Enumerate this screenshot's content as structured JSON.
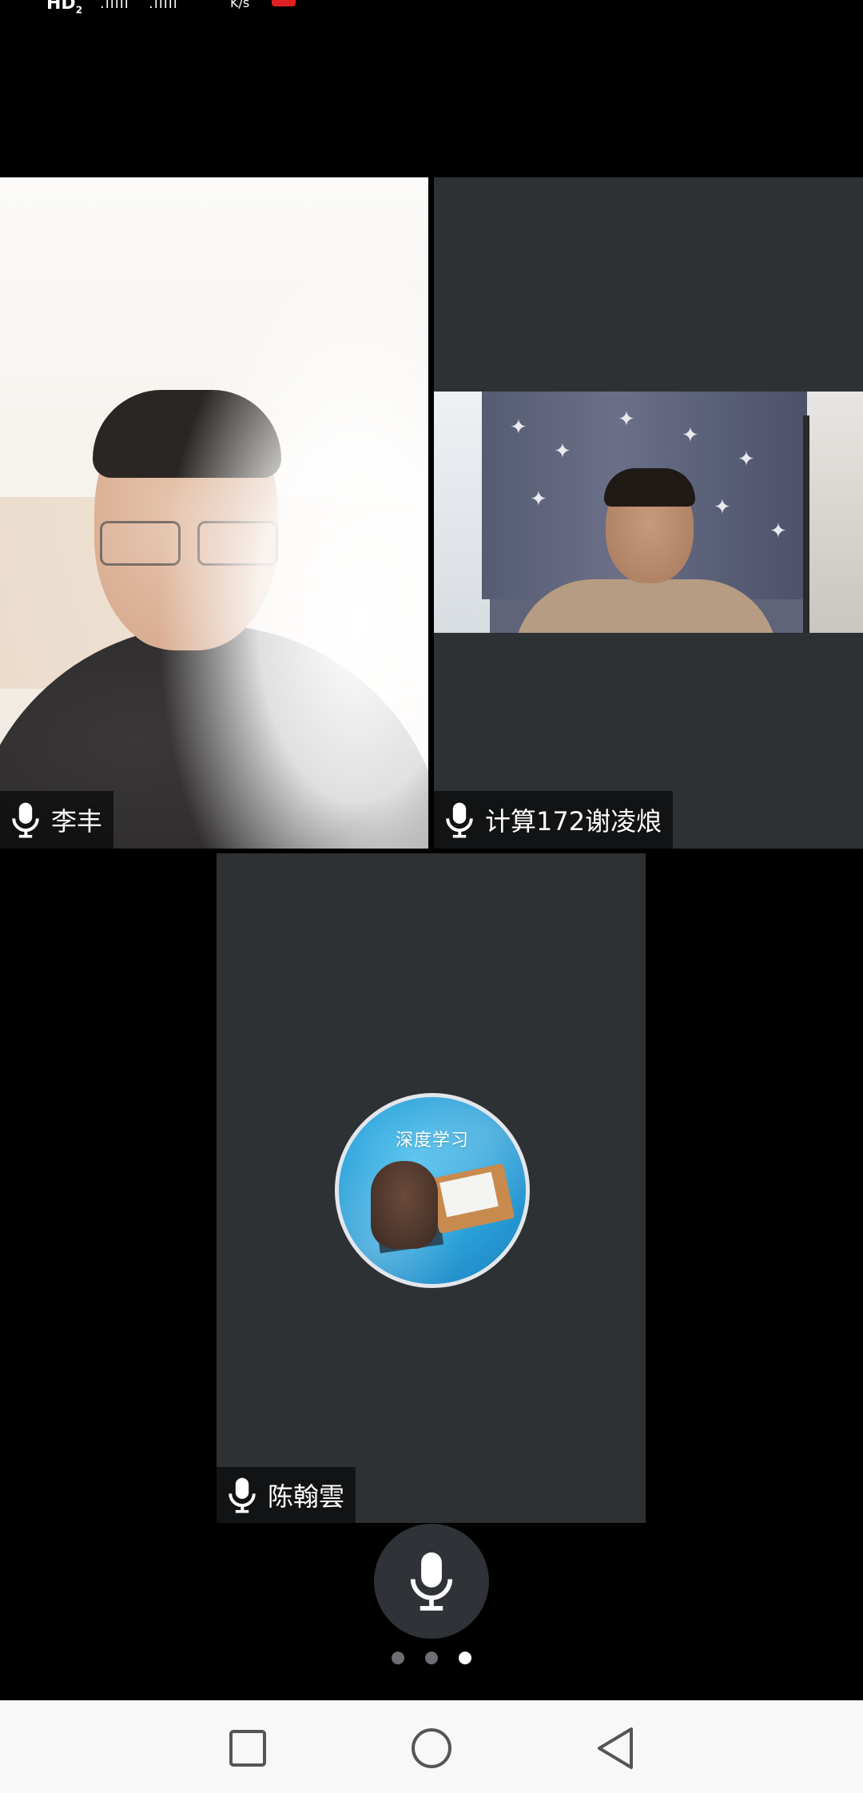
{
  "status_bar": {
    "hd_label": "HD",
    "hd_sub": "2",
    "signal_1": ".ıllıl",
    "signal_2": ".ıllıl",
    "speed_label": "K/s"
  },
  "participants": [
    {
      "name": "李丰",
      "mic": "mic-icon",
      "video_on": true
    },
    {
      "name": "计算172谢凌烺",
      "mic": "mic-icon",
      "video_on": true
    },
    {
      "name": "陈翰雲",
      "mic": "mic-icon",
      "video_on": false,
      "avatar_text": "深度学习"
    }
  ],
  "controls": {
    "mic_button_icon": "mic-icon",
    "page_indicator": {
      "count": 3,
      "active_index": 2
    }
  },
  "nav_bar": {
    "buttons": [
      "recent-apps-icon",
      "home-icon",
      "back-icon"
    ],
    "background": "#f8f8f8"
  },
  "colors": {
    "background": "#000000",
    "tile_background": "#2e3134",
    "label_background": "rgba(0,0,0,0.6)",
    "label_text": "#ffffff",
    "dot_active": "#ffffff",
    "dot_inactive": "#6b6e72"
  }
}
